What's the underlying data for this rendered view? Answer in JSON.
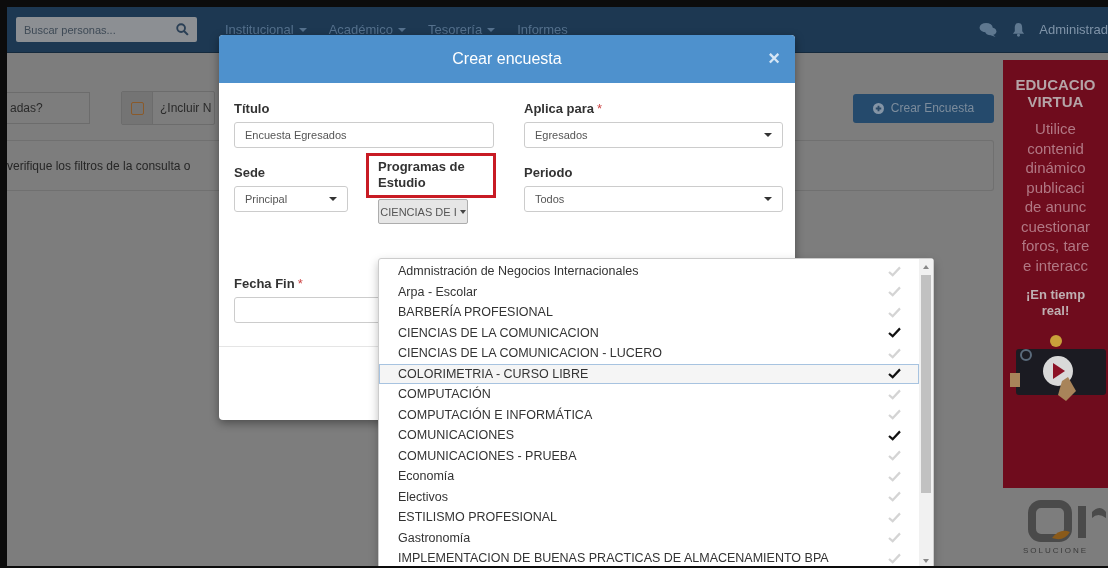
{
  "navbar": {
    "search": {
      "placeholder": "Buscar personas..."
    },
    "menus": [
      {
        "label": "Institucional",
        "caret": true
      },
      {
        "label": "Académico",
        "caret": true
      },
      {
        "label": "Tesorería",
        "caret": true
      },
      {
        "label": "Informes",
        "caret": false
      }
    ],
    "user": "Administrad"
  },
  "background": {
    "filter_field": "adas?",
    "checkbox": {
      "label": "¿Incluir N",
      "checked": false
    },
    "create_button": "Crear Encuesta",
    "notice": "verifique los filtros de la consulta o"
  },
  "ad": {
    "heading": [
      "EDUCACIO",
      "VIRTUA"
    ],
    "body": [
      "Utilice",
      "contenid",
      "dinámico",
      "publicaci",
      "de anunc",
      "cuestionar",
      "foros, tare",
      "e interacc"
    ],
    "tagline": [
      "¡En tiemp",
      "real!"
    ],
    "logo_caption": "SOLUCIONE"
  },
  "modal": {
    "title": "Crear encuesta",
    "close": "×",
    "titulo": {
      "label": "Título",
      "value": "Encuesta Egresados"
    },
    "aplica": {
      "label": "Aplica para",
      "required_mark": "*",
      "value": "Egresados"
    },
    "sede": {
      "label": "Sede",
      "value": "Principal"
    },
    "programas": {
      "label": "Programas de Estudio",
      "highlighted": true,
      "value": "CIENCIAS DE I"
    },
    "periodo": {
      "label": "Periodo",
      "value": "Todos"
    },
    "fecha_fin": {
      "label": "Fecha Fin",
      "required_mark": "*"
    }
  },
  "dropdown": {
    "options": [
      {
        "label": "Admnistración de Negocios Internacionales",
        "checked": false,
        "highlighted": false
      },
      {
        "label": "Arpa - Escolar",
        "checked": false,
        "highlighted": false
      },
      {
        "label": "BARBERÍA PROFESIONAL",
        "checked": false,
        "highlighted": false
      },
      {
        "label": "CIENCIAS DE LA COMUNICACION",
        "checked": true,
        "highlighted": false
      },
      {
        "label": "CIENCIAS DE LA COMUNICACION - LUCERO",
        "checked": false,
        "highlighted": false
      },
      {
        "label": "COLORIMETRIA - CURSO LIBRE",
        "checked": true,
        "highlighted": true
      },
      {
        "label": "COMPUTACIÓN",
        "checked": false,
        "highlighted": false
      },
      {
        "label": "COMPUTACIÓN E INFORMÁTICA",
        "checked": false,
        "highlighted": false
      },
      {
        "label": "COMUNICACIONES",
        "checked": true,
        "highlighted": false
      },
      {
        "label": "COMUNICACIONES - PRUEBA",
        "checked": false,
        "highlighted": false
      },
      {
        "label": "Economía",
        "checked": false,
        "highlighted": false
      },
      {
        "label": "Electivos",
        "checked": false,
        "highlighted": false
      },
      {
        "label": "ESTILISMO PROFESIONAL",
        "checked": false,
        "highlighted": false
      },
      {
        "label": "Gastronomía",
        "checked": false,
        "highlighted": false
      },
      {
        "label": "IMPLEMENTACION DE BUENAS PRACTICAS DE ALMACENAMIENTO BPA",
        "checked": false,
        "highlighted": false
      }
    ]
  }
}
